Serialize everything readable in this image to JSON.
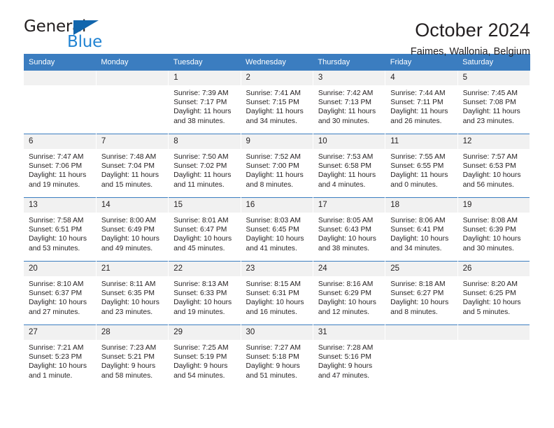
{
  "brand": {
    "name_top": "General",
    "name_bottom": "Blue",
    "triangle_color": "#1266ad",
    "blue_color": "#2183d2"
  },
  "header": {
    "title": "October 2024",
    "subtitle": "Faimes, Wallonia, Belgium"
  },
  "theme": {
    "header_blue": "#3b7dc0",
    "daynum_gray": "#f1f1f1",
    "text": "#231f20"
  },
  "weekday_headers": [
    "Sunday",
    "Monday",
    "Tuesday",
    "Wednesday",
    "Thursday",
    "Friday",
    "Saturday"
  ],
  "weeks": [
    [
      {
        "day": "",
        "sunrise": "",
        "sunset": "",
        "daylight1": "",
        "daylight2": ""
      },
      {
        "day": "",
        "sunrise": "",
        "sunset": "",
        "daylight1": "",
        "daylight2": ""
      },
      {
        "day": "1",
        "sunrise": "Sunrise: 7:39 AM",
        "sunset": "Sunset: 7:17 PM",
        "daylight1": "Daylight: 11 hours",
        "daylight2": "and 38 minutes."
      },
      {
        "day": "2",
        "sunrise": "Sunrise: 7:41 AM",
        "sunset": "Sunset: 7:15 PM",
        "daylight1": "Daylight: 11 hours",
        "daylight2": "and 34 minutes."
      },
      {
        "day": "3",
        "sunrise": "Sunrise: 7:42 AM",
        "sunset": "Sunset: 7:13 PM",
        "daylight1": "Daylight: 11 hours",
        "daylight2": "and 30 minutes."
      },
      {
        "day": "4",
        "sunrise": "Sunrise: 7:44 AM",
        "sunset": "Sunset: 7:11 PM",
        "daylight1": "Daylight: 11 hours",
        "daylight2": "and 26 minutes."
      },
      {
        "day": "5",
        "sunrise": "Sunrise: 7:45 AM",
        "sunset": "Sunset: 7:08 PM",
        "daylight1": "Daylight: 11 hours",
        "daylight2": "and 23 minutes."
      }
    ],
    [
      {
        "day": "6",
        "sunrise": "Sunrise: 7:47 AM",
        "sunset": "Sunset: 7:06 PM",
        "daylight1": "Daylight: 11 hours",
        "daylight2": "and 19 minutes."
      },
      {
        "day": "7",
        "sunrise": "Sunrise: 7:48 AM",
        "sunset": "Sunset: 7:04 PM",
        "daylight1": "Daylight: 11 hours",
        "daylight2": "and 15 minutes."
      },
      {
        "day": "8",
        "sunrise": "Sunrise: 7:50 AM",
        "sunset": "Sunset: 7:02 PM",
        "daylight1": "Daylight: 11 hours",
        "daylight2": "and 11 minutes."
      },
      {
        "day": "9",
        "sunrise": "Sunrise: 7:52 AM",
        "sunset": "Sunset: 7:00 PM",
        "daylight1": "Daylight: 11 hours",
        "daylight2": "and 8 minutes."
      },
      {
        "day": "10",
        "sunrise": "Sunrise: 7:53 AM",
        "sunset": "Sunset: 6:58 PM",
        "daylight1": "Daylight: 11 hours",
        "daylight2": "and 4 minutes."
      },
      {
        "day": "11",
        "sunrise": "Sunrise: 7:55 AM",
        "sunset": "Sunset: 6:55 PM",
        "daylight1": "Daylight: 11 hours",
        "daylight2": "and 0 minutes."
      },
      {
        "day": "12",
        "sunrise": "Sunrise: 7:57 AM",
        "sunset": "Sunset: 6:53 PM",
        "daylight1": "Daylight: 10 hours",
        "daylight2": "and 56 minutes."
      }
    ],
    [
      {
        "day": "13",
        "sunrise": "Sunrise: 7:58 AM",
        "sunset": "Sunset: 6:51 PM",
        "daylight1": "Daylight: 10 hours",
        "daylight2": "and 53 minutes."
      },
      {
        "day": "14",
        "sunrise": "Sunrise: 8:00 AM",
        "sunset": "Sunset: 6:49 PM",
        "daylight1": "Daylight: 10 hours",
        "daylight2": "and 49 minutes."
      },
      {
        "day": "15",
        "sunrise": "Sunrise: 8:01 AM",
        "sunset": "Sunset: 6:47 PM",
        "daylight1": "Daylight: 10 hours",
        "daylight2": "and 45 minutes."
      },
      {
        "day": "16",
        "sunrise": "Sunrise: 8:03 AM",
        "sunset": "Sunset: 6:45 PM",
        "daylight1": "Daylight: 10 hours",
        "daylight2": "and 41 minutes."
      },
      {
        "day": "17",
        "sunrise": "Sunrise: 8:05 AM",
        "sunset": "Sunset: 6:43 PM",
        "daylight1": "Daylight: 10 hours",
        "daylight2": "and 38 minutes."
      },
      {
        "day": "18",
        "sunrise": "Sunrise: 8:06 AM",
        "sunset": "Sunset: 6:41 PM",
        "daylight1": "Daylight: 10 hours",
        "daylight2": "and 34 minutes."
      },
      {
        "day": "19",
        "sunrise": "Sunrise: 8:08 AM",
        "sunset": "Sunset: 6:39 PM",
        "daylight1": "Daylight: 10 hours",
        "daylight2": "and 30 minutes."
      }
    ],
    [
      {
        "day": "20",
        "sunrise": "Sunrise: 8:10 AM",
        "sunset": "Sunset: 6:37 PM",
        "daylight1": "Daylight: 10 hours",
        "daylight2": "and 27 minutes."
      },
      {
        "day": "21",
        "sunrise": "Sunrise: 8:11 AM",
        "sunset": "Sunset: 6:35 PM",
        "daylight1": "Daylight: 10 hours",
        "daylight2": "and 23 minutes."
      },
      {
        "day": "22",
        "sunrise": "Sunrise: 8:13 AM",
        "sunset": "Sunset: 6:33 PM",
        "daylight1": "Daylight: 10 hours",
        "daylight2": "and 19 minutes."
      },
      {
        "day": "23",
        "sunrise": "Sunrise: 8:15 AM",
        "sunset": "Sunset: 6:31 PM",
        "daylight1": "Daylight: 10 hours",
        "daylight2": "and 16 minutes."
      },
      {
        "day": "24",
        "sunrise": "Sunrise: 8:16 AM",
        "sunset": "Sunset: 6:29 PM",
        "daylight1": "Daylight: 10 hours",
        "daylight2": "and 12 minutes."
      },
      {
        "day": "25",
        "sunrise": "Sunrise: 8:18 AM",
        "sunset": "Sunset: 6:27 PM",
        "daylight1": "Daylight: 10 hours",
        "daylight2": "and 8 minutes."
      },
      {
        "day": "26",
        "sunrise": "Sunrise: 8:20 AM",
        "sunset": "Sunset: 6:25 PM",
        "daylight1": "Daylight: 10 hours",
        "daylight2": "and 5 minutes."
      }
    ],
    [
      {
        "day": "27",
        "sunrise": "Sunrise: 7:21 AM",
        "sunset": "Sunset: 5:23 PM",
        "daylight1": "Daylight: 10 hours",
        "daylight2": "and 1 minute."
      },
      {
        "day": "28",
        "sunrise": "Sunrise: 7:23 AM",
        "sunset": "Sunset: 5:21 PM",
        "daylight1": "Daylight: 9 hours",
        "daylight2": "and 58 minutes."
      },
      {
        "day": "29",
        "sunrise": "Sunrise: 7:25 AM",
        "sunset": "Sunset: 5:19 PM",
        "daylight1": "Daylight: 9 hours",
        "daylight2": "and 54 minutes."
      },
      {
        "day": "30",
        "sunrise": "Sunrise: 7:27 AM",
        "sunset": "Sunset: 5:18 PM",
        "daylight1": "Daylight: 9 hours",
        "daylight2": "and 51 minutes."
      },
      {
        "day": "31",
        "sunrise": "Sunrise: 7:28 AM",
        "sunset": "Sunset: 5:16 PM",
        "daylight1": "Daylight: 9 hours",
        "daylight2": "and 47 minutes."
      },
      {
        "day": "",
        "sunrise": "",
        "sunset": "",
        "daylight1": "",
        "daylight2": ""
      },
      {
        "day": "",
        "sunrise": "",
        "sunset": "",
        "daylight1": "",
        "daylight2": ""
      }
    ]
  ]
}
